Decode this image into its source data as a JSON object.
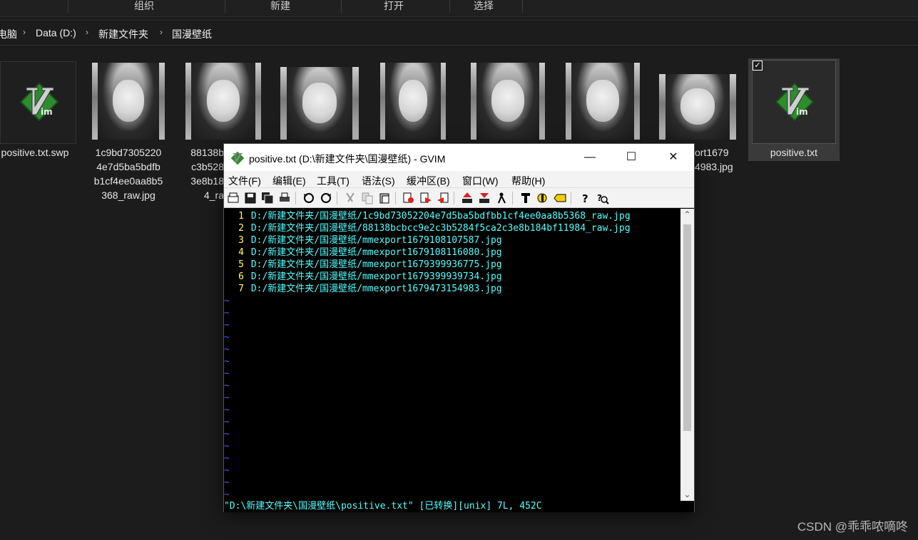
{
  "explorer": {
    "ribbon": {
      "groups": [
        "组织",
        "新建",
        "打开",
        "选择"
      ]
    },
    "breadcrumb": [
      "电脑",
      "Data (D:)",
      "新建文件夹",
      "国漫壁纸"
    ],
    "files": [
      {
        "name": "positive.txt.swp",
        "kind": "vim"
      },
      {
        "name": "1c9bd7305220\n4e7d5ba5bdfb\nb1cf4ee0aa8b5\n368_raw.jpg",
        "kind": "photo"
      },
      {
        "name": "88138b\nc3b528\n3e8b18\n4_ra",
        "kind": "photo"
      },
      {
        "name": "",
        "kind": "photo"
      },
      {
        "name": "",
        "kind": "photo"
      },
      {
        "name": "",
        "kind": "photo"
      },
      {
        "name": "",
        "kind": "photo"
      },
      {
        "name": "ort1679\n4983.jpg",
        "kind": "photo"
      },
      {
        "name": "positive.txt",
        "kind": "vim",
        "selected": true
      }
    ]
  },
  "gvim": {
    "title": "positive.txt (D:\\新建文件夹\\国漫壁纸) - GVIM",
    "window_buttons": {
      "minimize": "—",
      "maximize": "☐",
      "close": "✕"
    },
    "menu": [
      "文件(F)",
      "编辑(E)",
      "工具(T)",
      "语法(S)",
      "缓冲区(B)",
      "窗口(W)",
      "帮助(H)"
    ],
    "toolbar_icons": [
      "open-icon",
      "save-icon",
      "save-all-icon",
      "print-icon",
      "undo-icon",
      "redo-icon",
      "cut-icon",
      "copy-icon",
      "paste-icon",
      "find-replace-icon",
      "find-next-icon",
      "find-prev-icon",
      "load-session-icon",
      "save-session-icon",
      "run-script-icon",
      "make-icon",
      "shell-icon",
      "ctags-icon",
      "help-icon",
      "find-help-icon"
    ],
    "lines": [
      {
        "n": "1",
        "text": "D:/新建文件夹/国漫壁纸/1c9bd73052204e7d5ba5bdfbb1cf4ee0aa8b5368_raw.jpg"
      },
      {
        "n": "2",
        "text": "D:/新建文件夹/国漫壁纸/88138bcbcc9e2c3b5284f5ca2c3e8b184bf11984_raw.jpg"
      },
      {
        "n": "3",
        "text": "D:/新建文件夹/国漫壁纸/mmexport1679108107587.jpg"
      },
      {
        "n": "4",
        "text": "D:/新建文件夹/国漫壁纸/mmexport1679108116080.jpg"
      },
      {
        "n": "5",
        "text": "D:/新建文件夹/国漫壁纸/mmexport1679399936775.jpg"
      },
      {
        "n": "6",
        "text": "D:/新建文件夹/国漫壁纸/mmexport1679399939734.jpg"
      },
      {
        "n": "7",
        "text": "D:/新建文件夹/国漫壁纸/mmexport1679473154983.jpg"
      }
    ],
    "empty_line_marker": "~",
    "status_line": "\"D:\\新建文件夹\\国漫壁纸\\positive.txt\" [已转换][unix] 7L, 452C",
    "colors": {
      "line_number": "#ffff55",
      "text": "#55ffff",
      "tilde": "#5555ff",
      "background": "#000000"
    }
  },
  "watermark": "CSDN @乖乖哝嘀咚"
}
